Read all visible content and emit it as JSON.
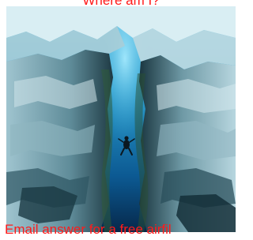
{
  "image": {
    "subject": "underwater-cave-crevasse-with-diver"
  },
  "captions": {
    "top": "Where am I?",
    "bottom": "Email answer for a free airfil"
  },
  "colors": {
    "caption": "#ff1a1a",
    "water_deep": "#0a3f6e",
    "water_light": "#4cc3e6",
    "rock_light": "#cfe3ea",
    "rock_dark": "#1e3a44"
  }
}
